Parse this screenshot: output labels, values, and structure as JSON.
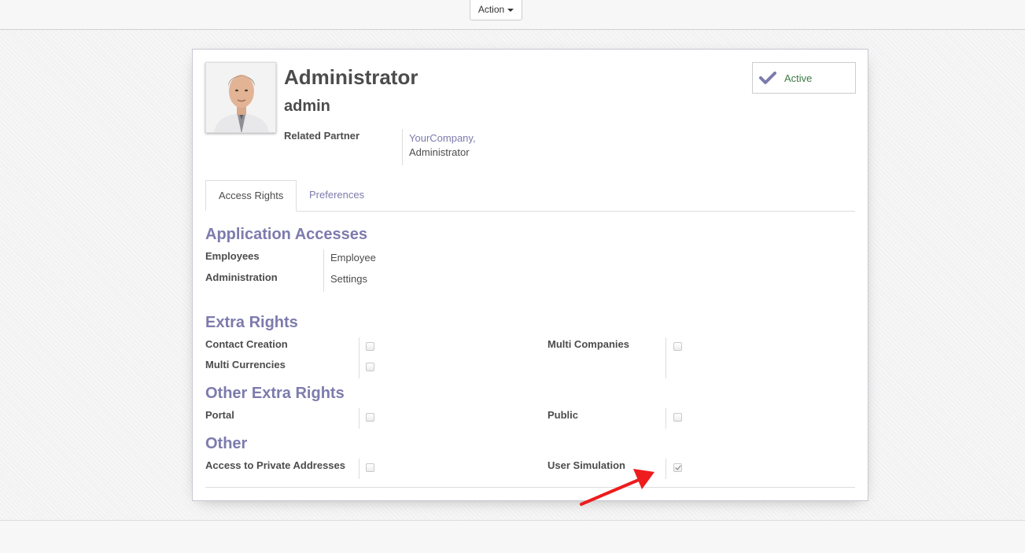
{
  "toolbar": {
    "action_label": "Action"
  },
  "record": {
    "name": "Administrator",
    "login": "admin",
    "avatar_icon": "user-photo-icon",
    "related_partner_label": "Related Partner",
    "related_partner_line1": "YourCompany,",
    "related_partner_line2": "Administrator"
  },
  "status": {
    "label": "Active",
    "icon": "check-icon",
    "color": "#3d7a45"
  },
  "tabs": [
    {
      "label": "Access Rights",
      "active": true
    },
    {
      "label": "Preferences",
      "active": false
    }
  ],
  "sections": {
    "app_accesses": {
      "title": "Application Accesses",
      "rows": [
        {
          "label": "Employees",
          "value": "Employee"
        },
        {
          "label": "Administration",
          "value": "Settings"
        }
      ]
    },
    "extra_rights": {
      "title": "Extra Rights",
      "rows": [
        {
          "label": "Contact Creation",
          "checked": false
        },
        {
          "label": "Multi Currencies",
          "checked": false
        },
        {
          "label": "Multi Companies",
          "checked": false
        }
      ]
    },
    "other_extra_rights": {
      "title": "Other Extra Rights",
      "rows": [
        {
          "label": "Portal",
          "checked": false
        },
        {
          "label": "Public",
          "checked": false
        }
      ]
    },
    "other": {
      "title": "Other",
      "rows": [
        {
          "label": "Access to Private Addresses",
          "checked": false
        },
        {
          "label": "User Simulation",
          "checked": true
        }
      ]
    }
  },
  "annotation": {
    "arrow_color": "#ee1c1c"
  },
  "colors": {
    "accent": "#7c7bad",
    "text": "#4c4c4c"
  }
}
